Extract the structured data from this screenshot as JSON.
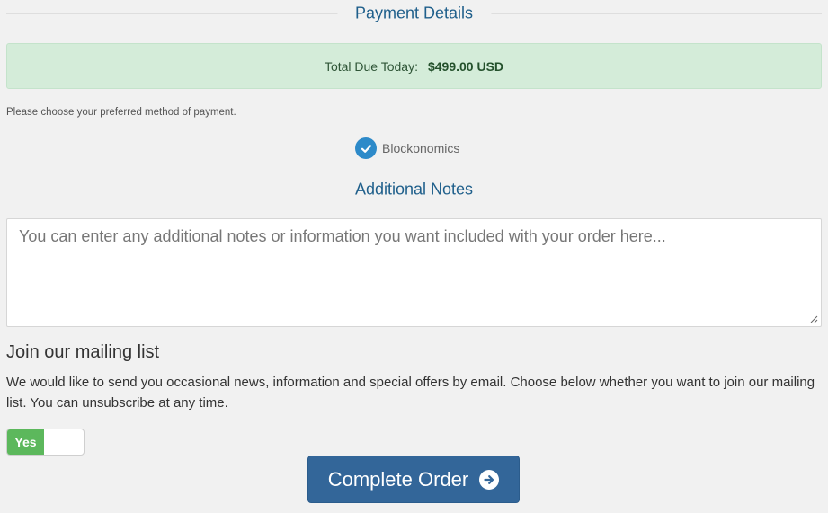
{
  "payment_section": {
    "heading": "Payment Details",
    "total_label": "Total Due Today:",
    "total_amount": "$499.00 USD",
    "choose_text": "Please choose your preferred method of payment.",
    "method": {
      "label": "Blockonomics",
      "selected": true,
      "icon": "check-circle-icon"
    }
  },
  "notes_section": {
    "heading": "Additional Notes",
    "placeholder": "You can enter any additional notes or information you want included with your order here...",
    "value": ""
  },
  "mailing_list": {
    "title": "Join our mailing list",
    "description": "We would like to send you occasional news, information and special offers by email. Choose below whether you want to join our mailing list. You can unsubscribe at any time.",
    "toggle_label": "Yes",
    "toggle_on": true
  },
  "actions": {
    "complete_label": "Complete Order",
    "complete_icon": "arrow-circle-right-icon"
  },
  "colors": {
    "background": "#f1f1f1",
    "heading": "#1f5f8b",
    "total_box": "#d4ecd9",
    "check": "#2d8ac9",
    "toggle_on": "#5cb85c",
    "primary_button": "#336699"
  }
}
